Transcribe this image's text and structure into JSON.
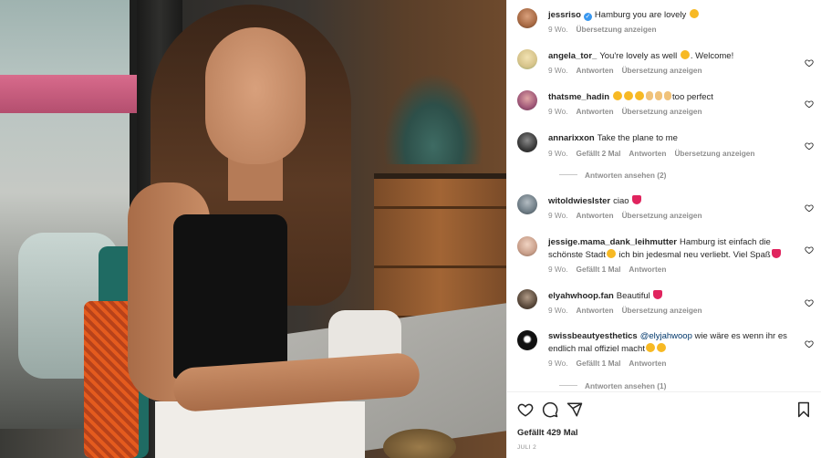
{
  "post": {
    "likes": "Gefällt 429 Mal",
    "date": "JULI 2"
  },
  "comments": [
    {
      "user": "jessriso",
      "verified": true,
      "text": "Hamburg you are lovely",
      "emoji_after": "smiling-face-with-hearts",
      "age": "9 Wo.",
      "actions": [
        "Übersetzung anzeigen"
      ],
      "avatar_color": "#a86a44"
    },
    {
      "user": "angela_tor_",
      "text": "You're lovely as well",
      "text_after": ". Welcome!",
      "emoji_after": "smiling-face",
      "age": "9 Wo.",
      "actions": [
        "Antworten",
        "Übersetzung anzeigen"
      ],
      "avatar_color": "#d6c38a"
    },
    {
      "user": "thatsme_hadin",
      "text": "too perfect",
      "emoji_before": "heart-eyes x3, clapping-hands x3",
      "age": "9 Wo.",
      "actions": [
        "Antworten",
        "Übersetzung anzeigen"
      ],
      "avatar_color": "#a05878"
    },
    {
      "user": "annarixxon",
      "text": "Take the plane to me",
      "age": "9 Wo.",
      "likes": "Gefällt 2 Mal",
      "actions": [
        "Antworten",
        "Übersetzung anzeigen"
      ],
      "replies": "Antworten ansehen (2)",
      "avatar_color": "#3a3a3a"
    },
    {
      "user": "witoldwiesIster",
      "text": "ciao",
      "emoji_after": "red-heart",
      "age": "9 Wo.",
      "actions": [
        "Antworten",
        "Übersetzung anzeigen"
      ],
      "avatar_color": "#6f7d86"
    },
    {
      "user": "jessige.mama_dank_leihmutter",
      "text": "Hamburg ist einfach die schönste Stadt",
      "text_mid": " ich bin jedesmal neu verliebt. Viel Spaß",
      "emoji_mid": "heart-eyes",
      "emoji_after": "red-heart",
      "age": "9 Wo.",
      "likes": "Gefällt 1 Mal",
      "actions": [
        "Antworten"
      ],
      "avatar_color": "#c99f8a"
    },
    {
      "user": "elyahwhoop.fan",
      "text": "Beautiful",
      "emoji_after": "red-heart",
      "age": "9 Wo.",
      "actions": [
        "Antworten",
        "Übersetzung anzeigen"
      ],
      "avatar_color": "#5b4a3c"
    },
    {
      "user": "swissbeautyesthetics",
      "mention": "@elyjahwoop",
      "text": " wie wäre es wenn ihr es endlich mal offiziel macht",
      "emoji_after": "grinning x2",
      "age": "9 Wo.",
      "likes": "Gefällt 1 Mal",
      "actions": [
        "Antworten"
      ],
      "replies": "Antworten ansehen (1)",
      "avatar_color": "#111111"
    }
  ],
  "actions_bar": {
    "icons": [
      "heart-icon",
      "comment-icon",
      "share-icon",
      "bookmark-icon"
    ]
  },
  "colors": {
    "text": "#262626",
    "muted": "#8e8e8e",
    "heart_red": "#e0245e",
    "verified_blue": "#3897f0",
    "mention_blue": "#00376b"
  }
}
